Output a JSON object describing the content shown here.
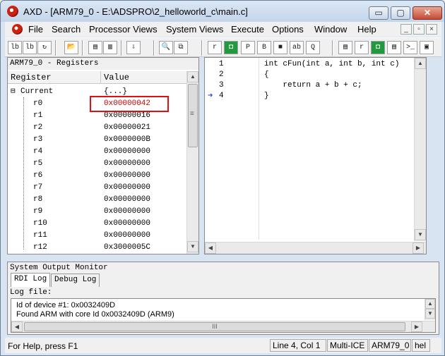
{
  "window": {
    "title": "AXD - [ARM79_0 - E:\\ADSPRO\\2_helloworld_c\\main.c]",
    "min_glyph": "▭",
    "max_glyph": "▢",
    "close_glyph": "✕"
  },
  "menu": {
    "items": [
      "File",
      "Search",
      "Processor Views",
      "System Views",
      "Execute",
      "Options",
      "Window",
      "Help"
    ],
    "mdi_min": "_",
    "mdi_restore": "▫",
    "mdi_close": "×"
  },
  "toolbar": {
    "left_icons": [
      "lb",
      "lb",
      "↻",
      "📂",
      "▤",
      "▥",
      "⇩",
      "🔍",
      "⧉"
    ],
    "right_icons": [
      "r",
      "◘",
      "P",
      "B",
      "■",
      "ab",
      "Q",
      "▤",
      "r",
      "◘",
      "▤",
      ">_",
      "▣"
    ]
  },
  "registers": {
    "pane_title": "ARM79_0 - Registers",
    "col_register": "Register",
    "col_value": "Value",
    "group_toggle": "⊟",
    "group_name": "Current",
    "group_value": "{...}",
    "rows": [
      {
        "name": "r0",
        "value": "0x00000042",
        "highlight": true
      },
      {
        "name": "r1",
        "value": "0x00000016"
      },
      {
        "name": "r2",
        "value": "0x00000021"
      },
      {
        "name": "r3",
        "value": "0x0000000B"
      },
      {
        "name": "r4",
        "value": "0x00000000"
      },
      {
        "name": "r5",
        "value": "0x00000000"
      },
      {
        "name": "r6",
        "value": "0x00000000"
      },
      {
        "name": "r7",
        "value": "0x00000000"
      },
      {
        "name": "r8",
        "value": "0x00000000"
      },
      {
        "name": "r9",
        "value": "0x00000000"
      },
      {
        "name": "r10",
        "value": "0x00000000"
      },
      {
        "name": "r11",
        "value": "0x00000000"
      },
      {
        "name": "r12",
        "value": "0x3000005C"
      }
    ],
    "highlight_color": "#e01010",
    "changed_color": "#cc0000"
  },
  "code": {
    "lines": [
      {
        "no": "1",
        "text": "int cFun(int a, int b, int c)"
      },
      {
        "no": "2",
        "text": "{"
      },
      {
        "no": "3",
        "text": "    return a + b + c;"
      },
      {
        "no": "4",
        "text": "}"
      }
    ],
    "current_line_marker": "➜"
  },
  "output": {
    "title": "System Output Monitor",
    "tabs": [
      "RDI Log",
      "Debug Log"
    ],
    "log_label": "Log file:",
    "log_lines": [
      "Id of device #1: 0x0032409D",
      "Found ARM with core Id 0x0032409D (ARM9)"
    ],
    "hscroll_grip": "III"
  },
  "status": {
    "help": "For Help, press F1",
    "position": "Line 4, Col 1",
    "target": "Multi-ICE",
    "processor": "ARM79_0",
    "extra": "hel"
  },
  "scroll": {
    "up": "▲",
    "down": "▼",
    "left": "◀",
    "right": "▶",
    "grip": "≡"
  }
}
